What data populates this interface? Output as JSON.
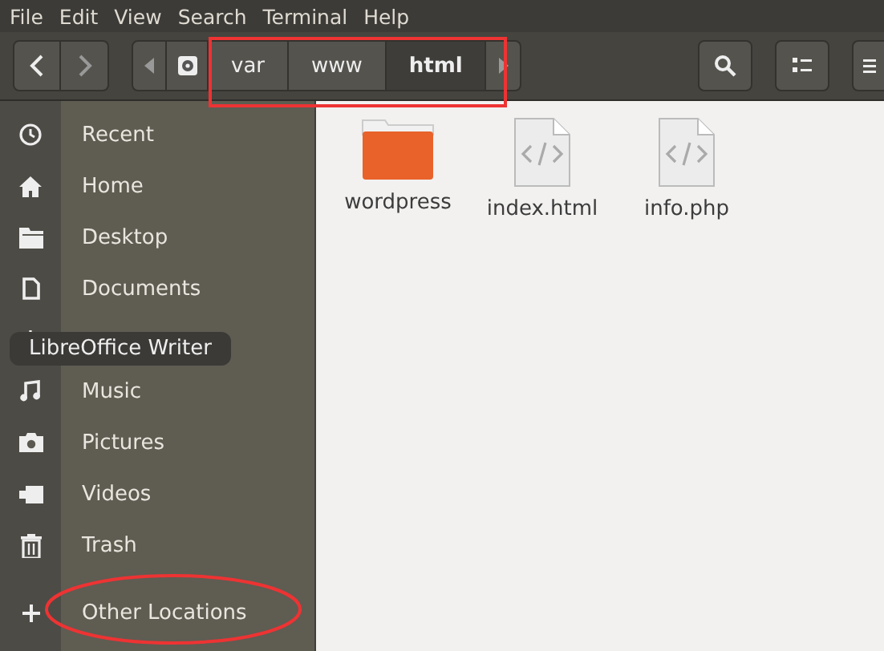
{
  "menu_bar": [
    "File",
    "Edit",
    "View",
    "Search",
    "Terminal",
    "Help"
  ],
  "path_bar": [
    {
      "label": "var",
      "selected": false
    },
    {
      "label": "www",
      "selected": false
    },
    {
      "label": "html",
      "selected": true
    }
  ],
  "sidebar": {
    "items": [
      {
        "label": "Recent",
        "kind": "recent"
      },
      {
        "label": "Home",
        "kind": "home"
      },
      {
        "label": "Desktop",
        "kind": "folder"
      },
      {
        "label": "Documents",
        "kind": "document"
      },
      {
        "kind": "download"
      },
      {
        "label": "Music",
        "kind": "music"
      },
      {
        "label": "Pictures",
        "kind": "camera"
      },
      {
        "label": "Videos",
        "kind": "video"
      },
      {
        "label": "Trash",
        "kind": "trash"
      }
    ],
    "other": {
      "label": "Other Locations"
    }
  },
  "tooltip": "LibreOffice Writer",
  "files": [
    {
      "name": "wordpress",
      "kind": "folder"
    },
    {
      "name": "index.html",
      "kind": "code"
    },
    {
      "name": "info.php",
      "kind": "code"
    }
  ]
}
